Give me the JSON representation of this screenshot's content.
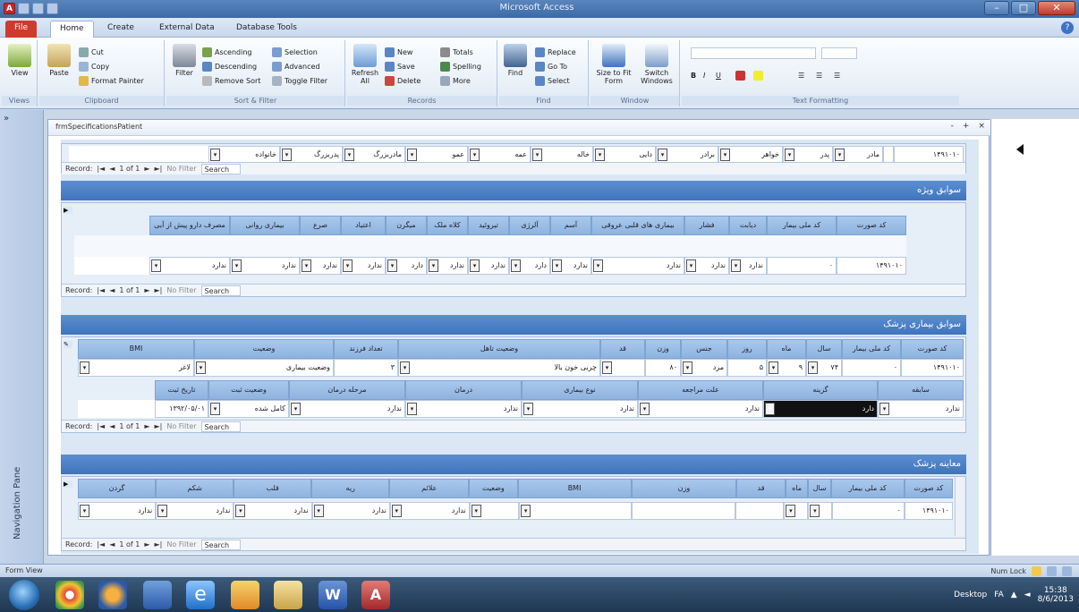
{
  "app": {
    "title": "Microsoft Access"
  },
  "tabs": [
    "File",
    "Home",
    "Create",
    "External Data",
    "Database Tools"
  ],
  "ribbon": {
    "groups": [
      {
        "label": "Views",
        "buttons": [
          "View"
        ]
      },
      {
        "label": "Clipboard",
        "buttons": [
          "Cut",
          "Copy",
          "Paste",
          "Format Painter"
        ]
      },
      {
        "label": "Sort & Filter",
        "buttons": [
          "Filter",
          "Ascending",
          "Descending",
          "Remove Sort",
          "Selection",
          "Advanced",
          "Toggle Filter"
        ]
      },
      {
        "label": "Records",
        "buttons": [
          "Refresh All",
          "New",
          "Save",
          "Delete",
          "Totals",
          "Spelling",
          "More"
        ]
      },
      {
        "label": "Find",
        "buttons": [
          "Find",
          "Replace",
          "Go To",
          "Select"
        ]
      },
      {
        "label": "Window",
        "buttons": [
          "Switch Windows",
          "Size to Fit Form"
        ]
      },
      {
        "label": "Text Formatting",
        "buttons": []
      }
    ]
  },
  "nav": {
    "label": "Navigation Pane",
    "toggle": "»"
  },
  "form": {
    "title": "frmSpecificationsPatient",
    "controls": [
      "-",
      "+",
      "×"
    ],
    "top_row": [
      "۱۴۹۱۰۱۰",
      "",
      "مادر",
      "پدر",
      "خواهر",
      "برادر",
      "دایی",
      "خاله",
      "عمه",
      "عمو",
      "مادربزرگ",
      "پدربزرگ",
      "خانواده"
    ],
    "sections": [
      {
        "title": "سوابق ویژه",
        "headers": [
          "کد صورت",
          "کد ملی بیمار",
          "دیابت",
          "فشار",
          "بیماری های قلبی عروقی",
          "آسم",
          "آلرژی",
          "تیروئید",
          "کلاه ملک",
          "میگرن",
          "اعتیاد",
          "صرع",
          "بیماری روانی",
          "مصرف دارو پیش از آبی"
        ],
        "values": [
          "۱۴۹۱۰۱۰",
          "۰",
          "ندارد",
          "ندارد",
          "ندارد",
          "ندارد",
          "دارد",
          "ندارد",
          "ندارد",
          "دارد",
          "ندارد",
          "ندارد",
          "ندارد",
          "ندارد"
        ]
      },
      {
        "title": "سوابق بیماری پزشک",
        "headers1": [
          "کد صورت",
          "کد ملی بیمار",
          "سال",
          "ماه",
          "روز",
          "جنس",
          "وزن",
          "قد",
          "وضعیت تاهل",
          "تعداد فرزند",
          "وضعیت",
          "BMI"
        ],
        "values1": [
          "۱۴۹۱۰۱۰",
          "۰",
          "۷۴",
          "۹",
          "۵",
          "مرد",
          "۸۰",
          "",
          "چربی خون بالا",
          "۳",
          "وضعیت بیماری",
          "لاغر"
        ],
        "headers2": [
          "سابقه",
          "گزینه",
          "علت مراجعه",
          "نوع بیماری",
          "درمان",
          "مرحله درمان",
          "وضعیت ثبت",
          "تاریخ ثبت"
        ],
        "values2": [
          "ندارد",
          "دارد",
          "ندارد",
          "ندارد",
          "ندارد",
          "ندارد",
          "کامل شده",
          "۱۳۹۲/۰۵/۰۱"
        ]
      },
      {
        "title": "معاینه پزشک",
        "headers": [
          "کد صورت",
          "کد ملی بیمار",
          "سال",
          "ماه",
          "قد",
          "وزن",
          "BMI",
          "وضعیت",
          "علائم",
          "ریه",
          "قلب",
          "شکم",
          "گردن"
        ],
        "values": [
          "۱۴۹۱۰۱۰",
          "۰",
          "",
          "",
          "",
          "",
          "",
          "",
          "ندارد",
          "ندارد",
          "ندارد",
          "ندارد",
          "ندارد"
        ]
      }
    ],
    "record_nav": {
      "record_label": "Record:",
      "position": "1 of 1",
      "no_filter": "No Filter",
      "search": "Search"
    }
  },
  "status": {
    "left": "Form View",
    "right": "Num Lock"
  },
  "taskbar": {
    "desktop": "Desktop",
    "time": "15:38",
    "date": "8/6/2013",
    "lang": "FA"
  }
}
